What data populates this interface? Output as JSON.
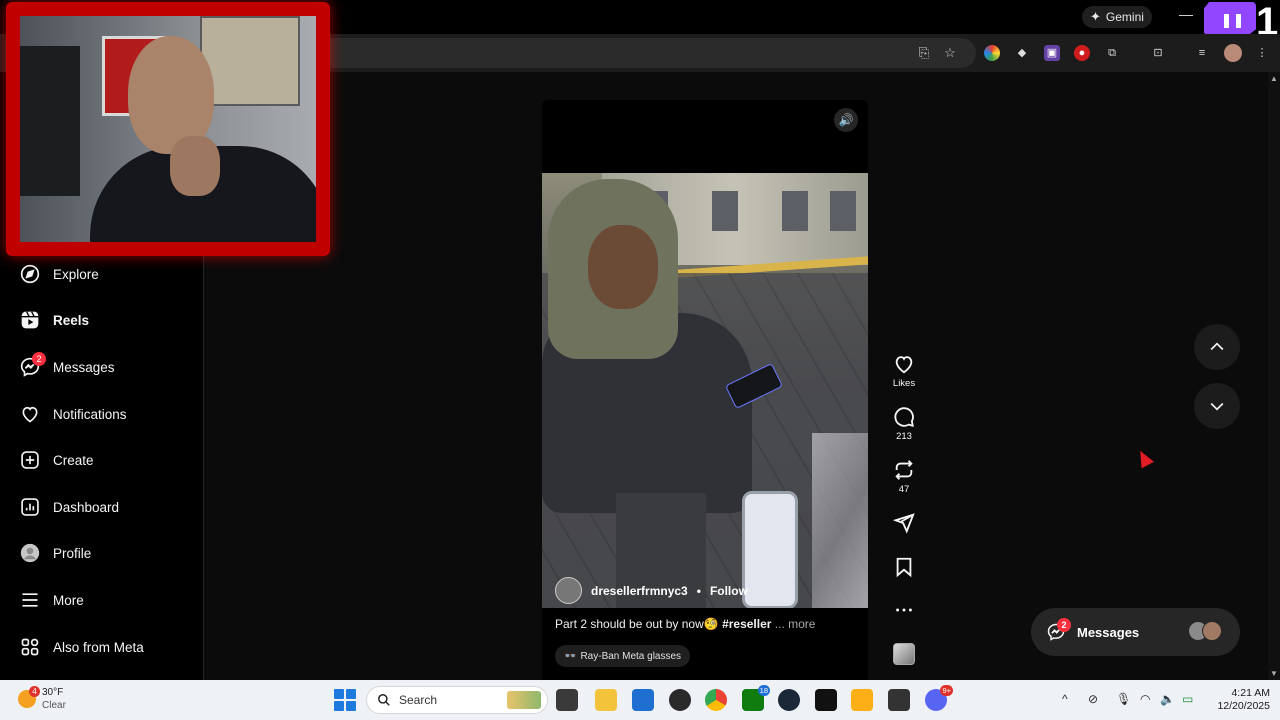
{
  "browser": {
    "gemini_label": "Gemini",
    "twitch_number": "1"
  },
  "sidebar": {
    "items": [
      {
        "label": "Explore",
        "icon": "compass-icon"
      },
      {
        "label": "Reels",
        "icon": "reels-icon"
      },
      {
        "label": "Messages",
        "icon": "messenger-icon",
        "badge": "2"
      },
      {
        "label": "Notifications",
        "icon": "heart-icon"
      },
      {
        "label": "Create",
        "icon": "plus-square-icon"
      },
      {
        "label": "Dashboard",
        "icon": "dashboard-icon"
      },
      {
        "label": "Profile",
        "icon": "profile-avatar"
      },
      {
        "label": "More",
        "icon": "menu-icon"
      },
      {
        "label": "Also from Meta",
        "icon": "meta-apps-icon"
      }
    ]
  },
  "reel": {
    "username": "dresellerfrmnyc3",
    "separator": "•",
    "follow_label": "Follow",
    "caption_text": "Part 2 should be out by now🧐",
    "caption_tag": "#reseller",
    "caption_more": "... more",
    "pill_label": "Ray-Ban Meta glasses"
  },
  "actions": {
    "likes_label": "Likes",
    "comments_count": "213",
    "reposts_count": "47"
  },
  "messages_pill": {
    "label": "Messages",
    "badge": "2"
  },
  "taskbar": {
    "temperature": "30°F",
    "condition": "Clear",
    "weather_badge": "4",
    "search_placeholder": "Search",
    "xbox_badge": "18",
    "discord_badge": "9+",
    "time": "4:21 AM",
    "date": "12/20/2025"
  },
  "colors": {
    "webcam_border": "#c00000",
    "twitch_purple": "#9146ff",
    "notification_red": "#ff3040",
    "cursor_red": "#e31b23"
  }
}
